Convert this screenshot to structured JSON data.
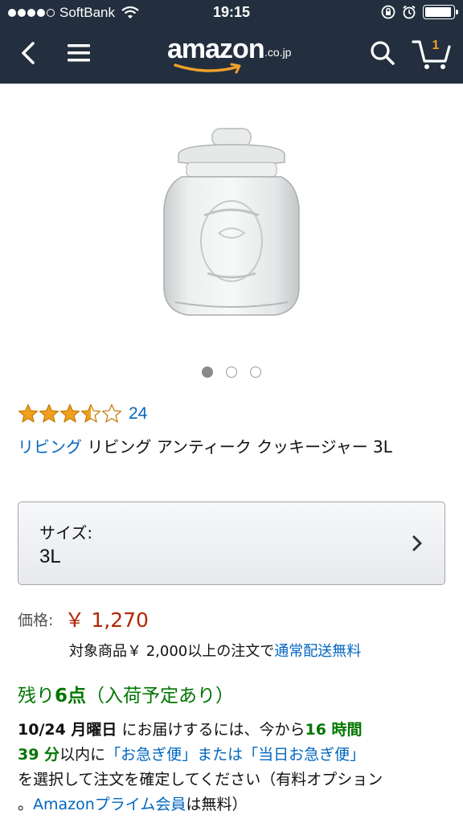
{
  "status_bar": {
    "carrier": "SoftBank",
    "time": "19:15",
    "battery_level": 0.95
  },
  "nav": {
    "logo_text": "amazon",
    "logo_suffix": ".co.jp",
    "cart_count": "1"
  },
  "product": {
    "image_icon": "cookie-jar-image",
    "carousel_total": 3,
    "carousel_active": 1,
    "rating": 3.5,
    "review_count": "24",
    "brand": "リビング",
    "title": " リビング アンティーク クッキージャー 3L"
  },
  "size": {
    "label": "サイズ:",
    "value": "3L"
  },
  "price": {
    "label": "価格:",
    "value": "￥ 1,270"
  },
  "shipping": {
    "text": "対象商品￥ 2,000以上の注文で",
    "link": "通常配送無料"
  },
  "stock": {
    "prefix": "残り",
    "count": "6点",
    "suffix": "（入荷予定あり）"
  },
  "delivery": {
    "date": "10/24 月曜日",
    "text1": " にお届けするには、今から",
    "hours": "16 時間",
    "minutes": "39 分",
    "text2": "以内に",
    "option_link": "「お急ぎ便」または「当日お急ぎ便」",
    "text3": "を選択して注文を確定してください（有料オプション",
    "text4": "。",
    "prime_link": "Amazonプライム会員",
    "text5": "は無料）"
  },
  "colors": {
    "header_bg": "#232f3e",
    "link": "#0066c0",
    "price": "#b12704",
    "stock": "#007600",
    "star": "#f0a01c",
    "cart_badge": "#f0a02a"
  }
}
